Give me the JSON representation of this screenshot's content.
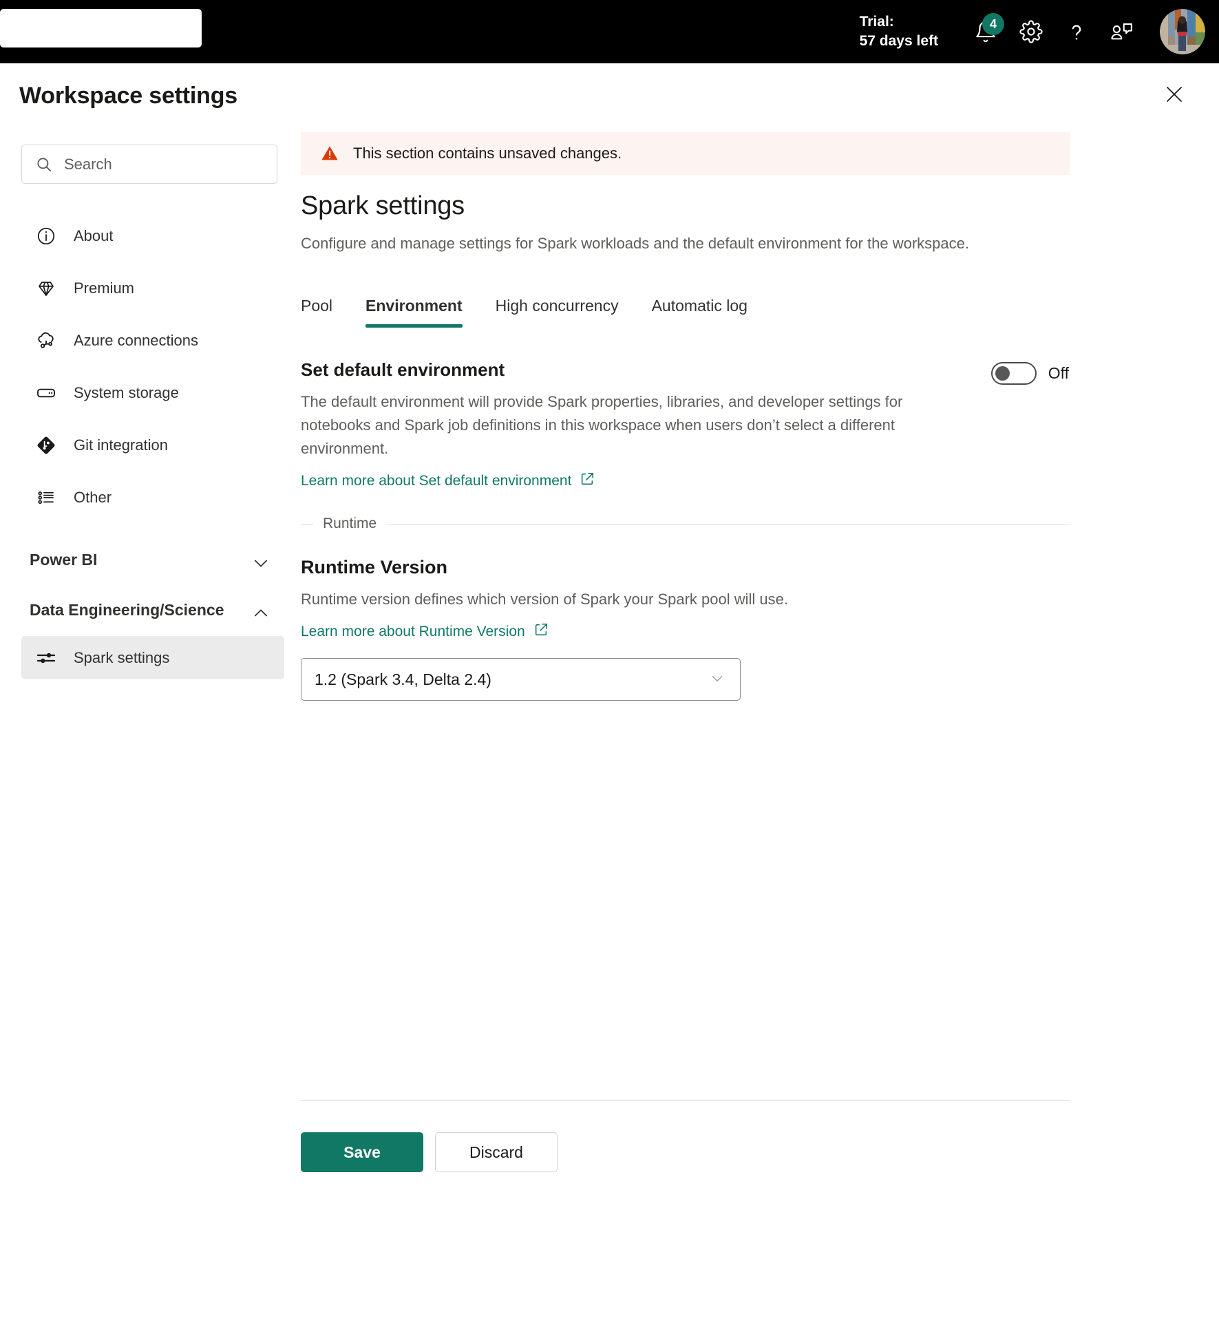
{
  "topbar": {
    "search_value": "",
    "trial_line1": "Trial:",
    "trial_line2": "57 days left",
    "notifications_count": "4",
    "icons": {
      "bell": "bell-icon",
      "settings": "gear-icon",
      "help": "question-mark-icon",
      "feedback": "feedback-icon",
      "avatar": "user-avatar"
    }
  },
  "header": {
    "title": "Workspace settings",
    "close_label": "Close"
  },
  "sidebar": {
    "search": {
      "placeholder": "Search",
      "value": ""
    },
    "items": [
      {
        "label": "About",
        "icon": "info-icon"
      },
      {
        "label": "Premium",
        "icon": "diamond-icon"
      },
      {
        "label": "Azure connections",
        "icon": "cloud-link-icon"
      },
      {
        "label": "System storage",
        "icon": "storage-icon"
      },
      {
        "label": "Git integration",
        "icon": "git-icon"
      },
      {
        "label": "Other",
        "icon": "list-icon"
      }
    ],
    "sections": [
      {
        "label": "Power BI",
        "expanded": false,
        "chevron": "chevron-down-icon",
        "items": []
      },
      {
        "label": "Data Engineering/Science",
        "expanded": true,
        "chevron": "chevron-up-icon",
        "items": [
          {
            "label": "Spark settings",
            "icon": "sliders-icon",
            "selected": true
          }
        ]
      }
    ]
  },
  "main": {
    "alert": {
      "icon": "warning-triangle-icon",
      "text": "This section contains unsaved changes."
    },
    "title": "Spark settings",
    "subtitle": "Configure and manage settings for Spark workloads and the default environment for the workspace.",
    "tabs": [
      {
        "label": "Pool",
        "active": false
      },
      {
        "label": "Environment",
        "active": true
      },
      {
        "label": "High concurrency",
        "active": false
      },
      {
        "label": "Automatic log",
        "active": false
      }
    ],
    "default_environment": {
      "title": "Set default environment",
      "toggle_state": "Off",
      "description": "The default environment will provide Spark properties, libraries, and developer settings for notebooks and Spark job definitions in this workspace when users don’t select a different environment.",
      "learn_more": "Learn more about Set default environment",
      "external_icon": "external-link-icon"
    },
    "runtime_divider_label": "Runtime",
    "runtime": {
      "title": "Runtime Version",
      "description": "Runtime version defines which version of Spark your Spark pool will use.",
      "learn_more": "Learn more about Runtime Version",
      "external_icon": "external-link-icon",
      "selected_value": "1.2 (Spark 3.4, Delta 2.4)",
      "chevron": "chevron-down-icon"
    },
    "footer": {
      "save_label": "Save",
      "discard_label": "Discard"
    }
  },
  "colors": {
    "accent_teal": "#117865",
    "alert_bg": "#fdf3f1",
    "alert_icon": "#d83b01",
    "topbar_bg": "#000000",
    "selected_nav_bg": "#ebebeb"
  }
}
